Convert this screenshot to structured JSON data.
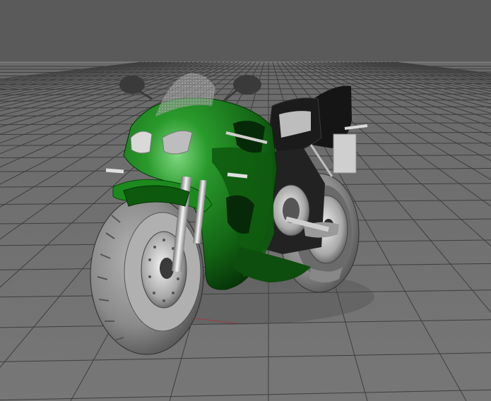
{
  "viewport": {
    "background_color": "#5c5c5c",
    "floor_color": "#6e6e6e",
    "grid_line_color": "#3c3c3c",
    "horizon_line_color": "#8a8a8a",
    "x_axis_color": "#c8323c"
  },
  "model": {
    "body_color": "#1b7a1e",
    "body_highlight_color": "#3fb040",
    "body_shadow_color": "#0a3a0c",
    "tire_color": "#8c8c8c",
    "chrome_color": "#d4d4d4",
    "seat_color": "#1a1a1a",
    "icons": [
      "motorcycle-model",
      "windscreen-mesh",
      "mirror-left",
      "mirror-right",
      "front-wheel",
      "rear-wheel",
      "brake-disc",
      "fork",
      "engine",
      "exhaust"
    ]
  }
}
